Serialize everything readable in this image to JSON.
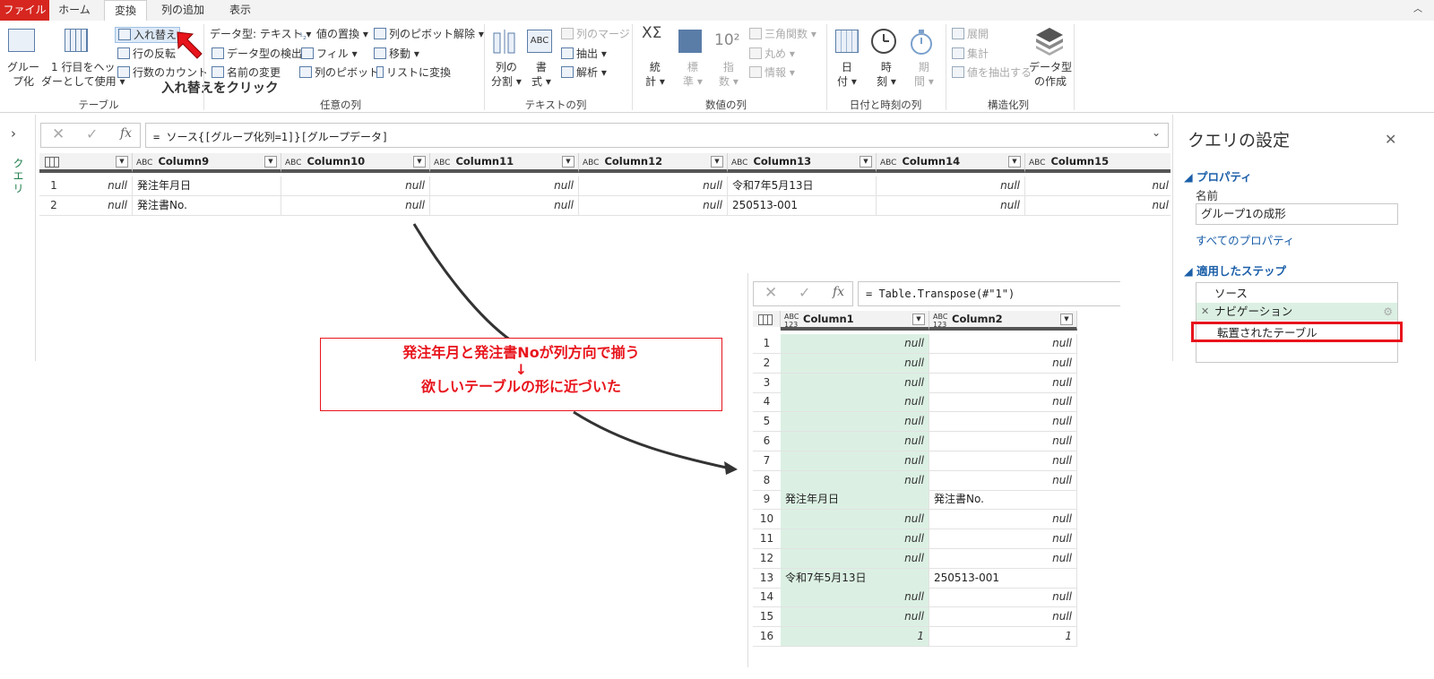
{
  "tabs": [
    "ファイル",
    "ホーム",
    "変換",
    "列の追加",
    "表示"
  ],
  "ribbon": {
    "table_group": {
      "label": "テーブル",
      "group_by": "グルー\nプ化",
      "use_first_row": "1 行目をヘッ\nダーとして使用 ▾",
      "transpose": "入れ替え",
      "reverse_rows": "行の反転",
      "count_rows": "行数のカウント"
    },
    "any_column_group": {
      "label": "任意の列",
      "data_type": "データ型: テキスト ▾",
      "detect_type": "データ型の検出",
      "rename": "名前の変更",
      "replace_values": "値の置換 ▾",
      "fill": "フィル ▾",
      "pivot_column": "列のピボット",
      "unpivot": "列のピボット解除 ▾",
      "move": "移動 ▾",
      "convert_to_list": "リストに変換"
    },
    "text_column_group": {
      "label": "テキストの列",
      "split_column": "列の\n分割 ▾",
      "format": "書\n式 ▾",
      "merge_columns": "列のマージ",
      "extract": "抽出 ▾",
      "parse": "解析 ▾"
    },
    "number_column_group": {
      "label": "数値の列",
      "statistics": "統\n計 ▾",
      "standard": "標\n準 ▾",
      "scientific": "指\n数 ▾",
      "trigonometry": "三角関数 ▾",
      "rounding": "丸め ▾",
      "information": "情報 ▾"
    },
    "datetime_group": {
      "label": "日付と時刻の列",
      "date": "日\n付 ▾",
      "time": "時\n刻 ▾",
      "duration": "期\n間 ▾"
    },
    "structured_group": {
      "label": "構造化列",
      "expand": "展開",
      "aggregate": "集計",
      "extract_values": "値を抽出する",
      "create_data_type": "データ型\nの作成"
    }
  },
  "callout_transpose": "入れ替えをクリック",
  "leftnav_label": "クエリ",
  "formula_main": "= ソース{[グループ化列=1]}[グループデータ]",
  "grid_main": {
    "columns": [
      "Column9",
      "Column10",
      "Column11",
      "Column12",
      "Column13",
      "Column14",
      "Column15"
    ],
    "rows": [
      {
        "num": "1",
        "cells": [
          "null",
          "発注年月日",
          "null",
          "null",
          "null",
          "令和7年5月13日",
          "null",
          "nul"
        ]
      },
      {
        "num": "2",
        "cells": [
          "null",
          "発注書No.",
          "null",
          "null",
          "null",
          "250513-001",
          "null",
          "nul"
        ]
      }
    ]
  },
  "annotation": {
    "line1": "発注年月と発注書Noが列方向で揃う",
    "line2": "↓",
    "line3": "欲しいテーブルの形に近づいた"
  },
  "formula_inset": "= Table.Transpose(#\"1\")",
  "grid_inset": {
    "type_label": "ABC\n123",
    "columns": [
      "Column1",
      "Column2"
    ],
    "rows": [
      [
        "1",
        "null",
        "null"
      ],
      [
        "2",
        "null",
        "null"
      ],
      [
        "3",
        "null",
        "null"
      ],
      [
        "4",
        "null",
        "null"
      ],
      [
        "5",
        "null",
        "null"
      ],
      [
        "6",
        "null",
        "null"
      ],
      [
        "7",
        "null",
        "null"
      ],
      [
        "8",
        "null",
        "null"
      ],
      [
        "9",
        "発注年月日",
        "発注書No."
      ],
      [
        "10",
        "null",
        "null"
      ],
      [
        "11",
        "null",
        "null"
      ],
      [
        "12",
        "null",
        "null"
      ],
      [
        "13",
        "令和7年5月13日",
        "250513-001"
      ],
      [
        "14",
        "null",
        "null"
      ],
      [
        "15",
        "null",
        "null"
      ],
      [
        "16",
        "1",
        "1"
      ]
    ]
  },
  "query_settings": {
    "title": "クエリの設定",
    "properties": "プロパティ",
    "name_label": "名前",
    "name_value": "グループ1の成形",
    "all_properties": "すべてのプロパティ",
    "applied_steps": "適用したステップ",
    "steps": [
      "ソース",
      "ナビゲーション",
      "転置されたテーブル"
    ]
  },
  "accent_colors": {
    "file_tab": "#d6261f",
    "highlight": "#e8141c",
    "annotation_text": "#e8141c",
    "selected_col": "#dbf0e3"
  }
}
